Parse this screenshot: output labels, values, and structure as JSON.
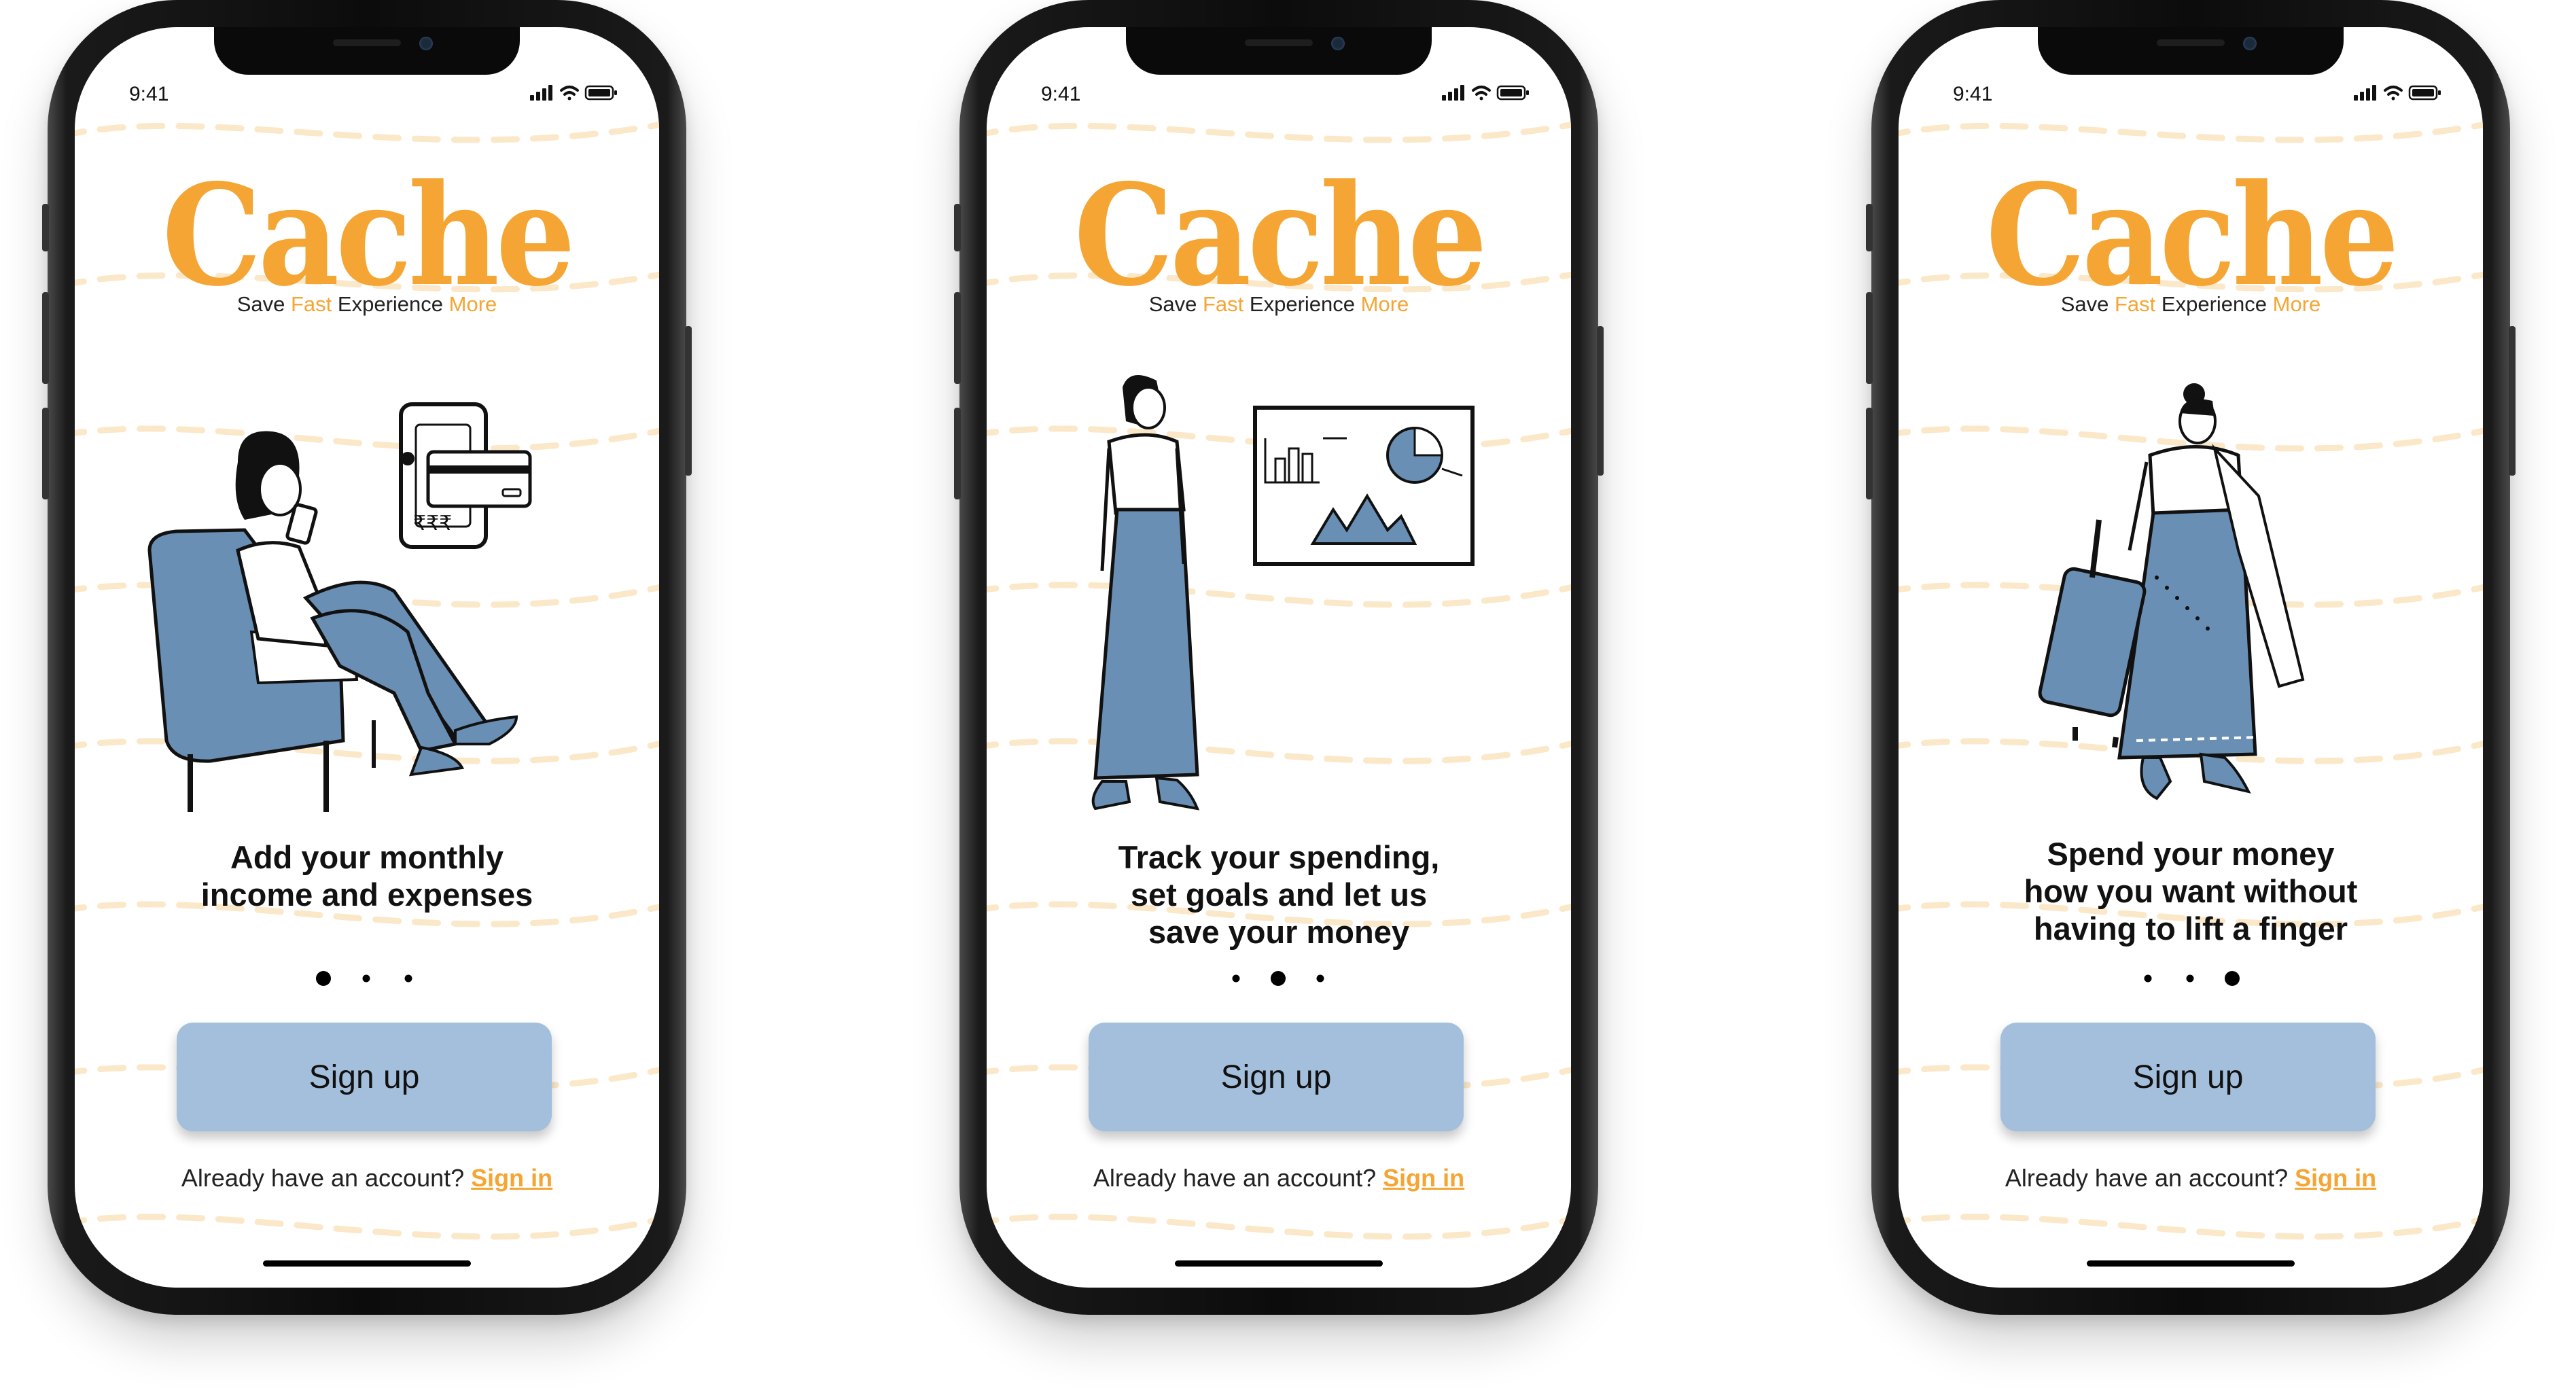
{
  "colors": {
    "accent": "#f5a534",
    "button": "#a4bfdb",
    "illustration_blue": "#6a8fb4",
    "wave": "#fbe8c9"
  },
  "screens": [
    {
      "time": "9:41",
      "logo": "Cache",
      "tagline": {
        "w1": "Save",
        "w2": "Fast",
        "w3": "Experience",
        "w4": "More"
      },
      "headline": [
        "Add your monthly",
        "income and expenses"
      ],
      "pager": {
        "active": 1,
        "total": 3
      },
      "signup_label": "Sign up",
      "account_prompt": "Already have an account?",
      "signin_label": "Sign in",
      "illustration_symbol": "₹₹₹"
    },
    {
      "time": "9:41",
      "logo": "Cache",
      "tagline": {
        "w1": "Save",
        "w2": "Fast",
        "w3": "Experience",
        "w4": "More"
      },
      "headline": [
        "Track your spending,",
        "set goals and let us",
        "save your money"
      ],
      "pager": {
        "active": 2,
        "total": 3
      },
      "signup_label": "Sign up",
      "account_prompt": "Already have an account?",
      "signin_label": "Sign in"
    },
    {
      "time": "9:41",
      "logo": "Cache",
      "tagline": {
        "w1": "Save",
        "w2": "Fast",
        "w3": "Experience",
        "w4": "More"
      },
      "headline": [
        "Spend your money",
        "how you want without",
        "having to lift a finger"
      ],
      "pager": {
        "active": 3,
        "total": 3
      },
      "signup_label": "Sign up",
      "account_prompt": "Already have an account?",
      "signin_label": "Sign in"
    }
  ]
}
